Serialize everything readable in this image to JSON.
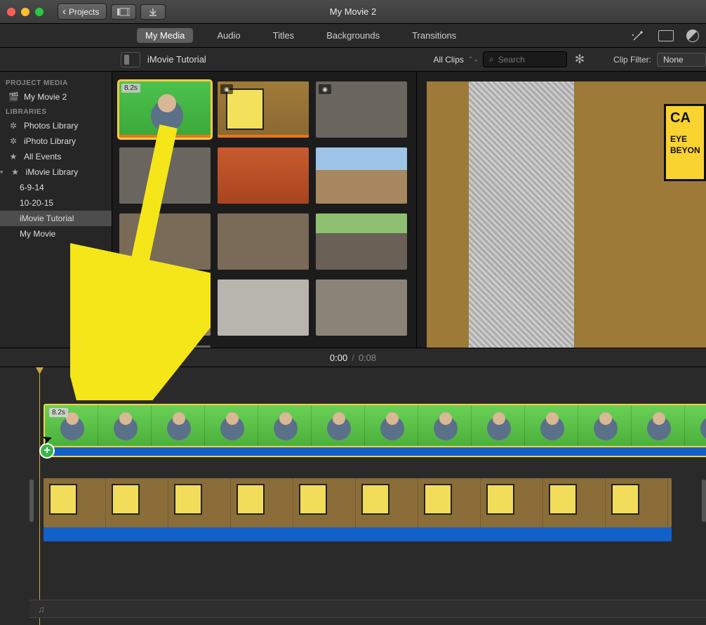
{
  "window": {
    "title": "My Movie 2"
  },
  "toolbar": {
    "projects": "Projects"
  },
  "tabs": {
    "my_media": "My Media",
    "audio": "Audio",
    "titles": "Titles",
    "backgrounds": "Backgrounds",
    "transitions": "Transitions"
  },
  "browser": {
    "breadcrumb": "iMovie Tutorial",
    "clips_filter": "All Clips",
    "search_placeholder": "Search"
  },
  "viewer_header": {
    "clip_filter_label": "Clip Filter:",
    "clip_filter_value": "None"
  },
  "sidebar": {
    "project_media_head": "PROJECT MEDIA",
    "project_name": "My Movie 2",
    "libraries_head": "LIBRARIES",
    "photos_library": "Photos Library",
    "iphoto_library": "iPhoto Library",
    "all_events": "All Events",
    "imovie_library": "iMovie Library",
    "events": {
      "e1": "6-9-14",
      "e2": "10-20-15",
      "e3": "iMovie Tutorial",
      "e4": "My Movie"
    }
  },
  "clips": {
    "selected_duration": "8.2s"
  },
  "preview_sign": {
    "line1": "CA",
    "line2": "EYE",
    "line3": "BEYON"
  },
  "timecode": {
    "current": "0:00",
    "separator": "/",
    "duration": "0:08"
  },
  "timeline": {
    "green_clip_duration": "8.2s",
    "add_symbol": "+",
    "music_icon": "♫"
  }
}
